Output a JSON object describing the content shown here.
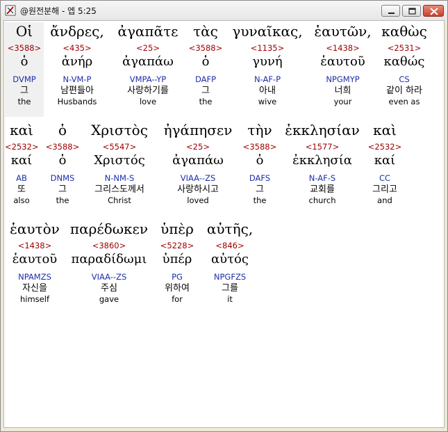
{
  "window": {
    "title": "@원전분해 - 엡 5:25"
  },
  "words": [
    {
      "greek": "Οἱ",
      "strong": "<3588>",
      "lemma": "ὁ",
      "parse": "DVMP",
      "korean": "그",
      "english": "the"
    },
    {
      "greek": "ἄνδρες,",
      "strong": "<435>",
      "lemma": "ἀνήρ",
      "parse": "N-VM-P",
      "korean": "남편들아",
      "english": "Husbands"
    },
    {
      "greek": "ἀγαπᾶτε",
      "strong": "<25>",
      "lemma": "ἀγαπάω",
      "parse": "VMPA--YP",
      "korean": "사랑하기를",
      "english": "love"
    },
    {
      "greek": "τὰς",
      "strong": "<3588>",
      "lemma": "ὁ",
      "parse": "DAFP",
      "korean": "그",
      "english": "the"
    },
    {
      "greek": "γυναῖκας,",
      "strong": "<1135>",
      "lemma": "γυνή",
      "parse": "N-AF-P",
      "korean": "아내",
      "english": "wive"
    },
    {
      "greek": "ἑαυτῶν,",
      "strong": "<1438>",
      "lemma": "ἑαυτοῦ",
      "parse": "NPGMYP",
      "korean": "너희",
      "english": "your"
    },
    {
      "greek": "καθὼς",
      "strong": "<2531>",
      "lemma": "καθώς",
      "parse": "CS",
      "korean": "같이 하라",
      "english": "even as"
    },
    {
      "greek": "καὶ",
      "strong": "<2532>",
      "lemma": "καί",
      "parse": "AB",
      "korean": "또",
      "english": "also"
    },
    {
      "greek": "ὁ",
      "strong": "<3588>",
      "lemma": "ὁ",
      "parse": "DNMS",
      "korean": "그",
      "english": "the"
    },
    {
      "greek": "Χριστὸς",
      "strong": "<5547>",
      "lemma": "Χριστός",
      "parse": "N-NM-S",
      "korean": "그리스도께서",
      "english": "Christ"
    },
    {
      "greek": "ἠγάπησεν",
      "strong": "<25>",
      "lemma": "ἀγαπάω",
      "parse": "VIAA--ZS",
      "korean": "사랑하시고",
      "english": "loved"
    },
    {
      "greek": "τὴν",
      "strong": "<3588>",
      "lemma": "ὁ",
      "parse": "DAFS",
      "korean": "그",
      "english": "the"
    },
    {
      "greek": "ἐκκλησίαν",
      "strong": "<1577>",
      "lemma": "ἐκκλησία",
      "parse": "N-AF-S",
      "korean": "교회를",
      "english": "church"
    },
    {
      "greek": "καὶ",
      "strong": "<2532>",
      "lemma": "καί",
      "parse": "CC",
      "korean": "그리고",
      "english": "and"
    },
    {
      "greek": "ἑαυτὸν",
      "strong": "<1438>",
      "lemma": "ἑαυτοῦ",
      "parse": "NPAMZS",
      "korean": "자신을",
      "english": "himself"
    },
    {
      "greek": "παρέδωκεν",
      "strong": "<3860>",
      "lemma": "παραδίδωμι",
      "parse": "VIAA--ZS",
      "korean": "주심",
      "english": "gave"
    },
    {
      "greek": "ὑπὲρ",
      "strong": "<5228>",
      "lemma": "ὑπέρ",
      "parse": "PG",
      "korean": "위하여",
      "english": "for"
    },
    {
      "greek": "αὐτῆς,",
      "strong": "<846>",
      "lemma": "αὐτός",
      "parse": "NPGFZS",
      "korean": "그를",
      "english": "it"
    }
  ],
  "colors": {
    "strong": "#a00000",
    "parse": "#1c2dab",
    "close_button": "#c6422c"
  },
  "icons": [
    "app-icon",
    "minimize-icon",
    "maximize-icon",
    "close-icon"
  ]
}
